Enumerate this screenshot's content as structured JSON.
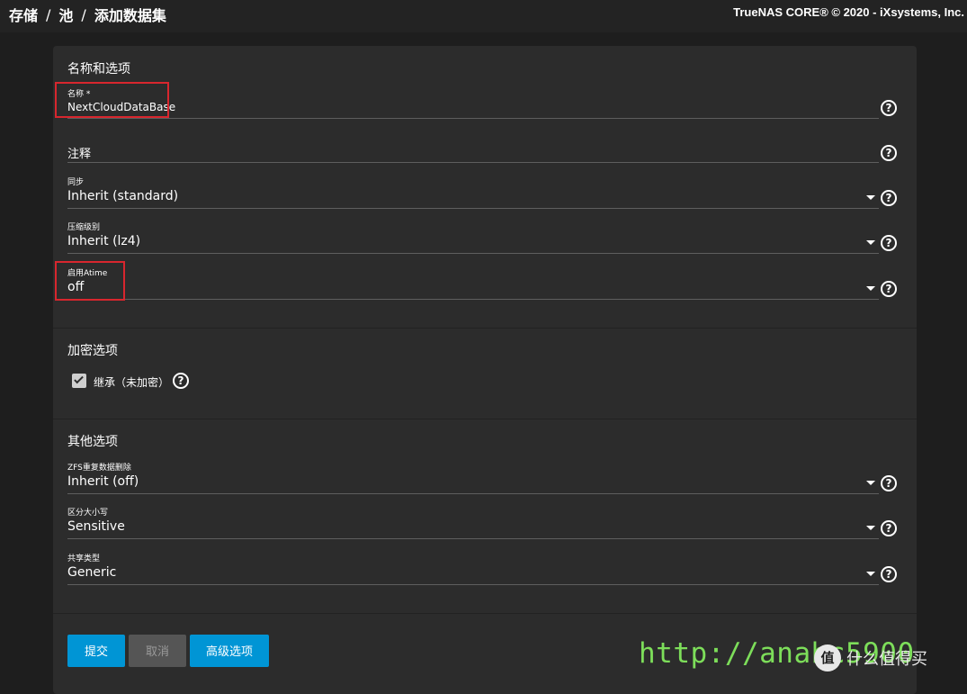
{
  "header": {
    "breadcrumb": [
      "存储",
      "池",
      "添加数据集"
    ],
    "separator": "/",
    "copyright": "TrueNAS CORE® © 2020 - iXsystems, Inc."
  },
  "sections": {
    "name_options": {
      "title": "名称和选项",
      "name": {
        "label": "名称 *",
        "value": "NextCloudDataBase"
      },
      "comments": {
        "label": "注释",
        "value": ""
      },
      "sync": {
        "label": "同步",
        "value": "Inherit (standard)"
      },
      "compression": {
        "label": "压缩级别",
        "value": "Inherit (lz4)"
      },
      "atime": {
        "label": "启用Atime",
        "value": "off"
      }
    },
    "encryption": {
      "title": "加密选项",
      "inherit_checkbox": {
        "label": "继承（未加密）",
        "checked": true
      }
    },
    "other": {
      "title": "其他选项",
      "dedup": {
        "label": "ZFS重复数据删除",
        "value": "Inherit (off)"
      },
      "case_sensitivity": {
        "label": "区分大小写",
        "value": "Sensitive"
      },
      "share_type": {
        "label": "共享类型",
        "value": "Generic"
      }
    }
  },
  "buttons": {
    "submit": "提交",
    "cancel": "取消",
    "advanced": "高级选项"
  },
  "help_glyph": "?",
  "watermark": {
    "url_text": "http://anahc5900",
    "site_mark": "值",
    "site_name": "什么值得买"
  },
  "colors": {
    "accent": "#0095d5",
    "highlight_box": "#d8262e",
    "watermark": "#7dde5a",
    "background": "#1e1e1e",
    "card": "#2c2c2c"
  },
  "icons": [
    "help-icon",
    "dropdown-arrow-icon",
    "checkmark-icon"
  ]
}
